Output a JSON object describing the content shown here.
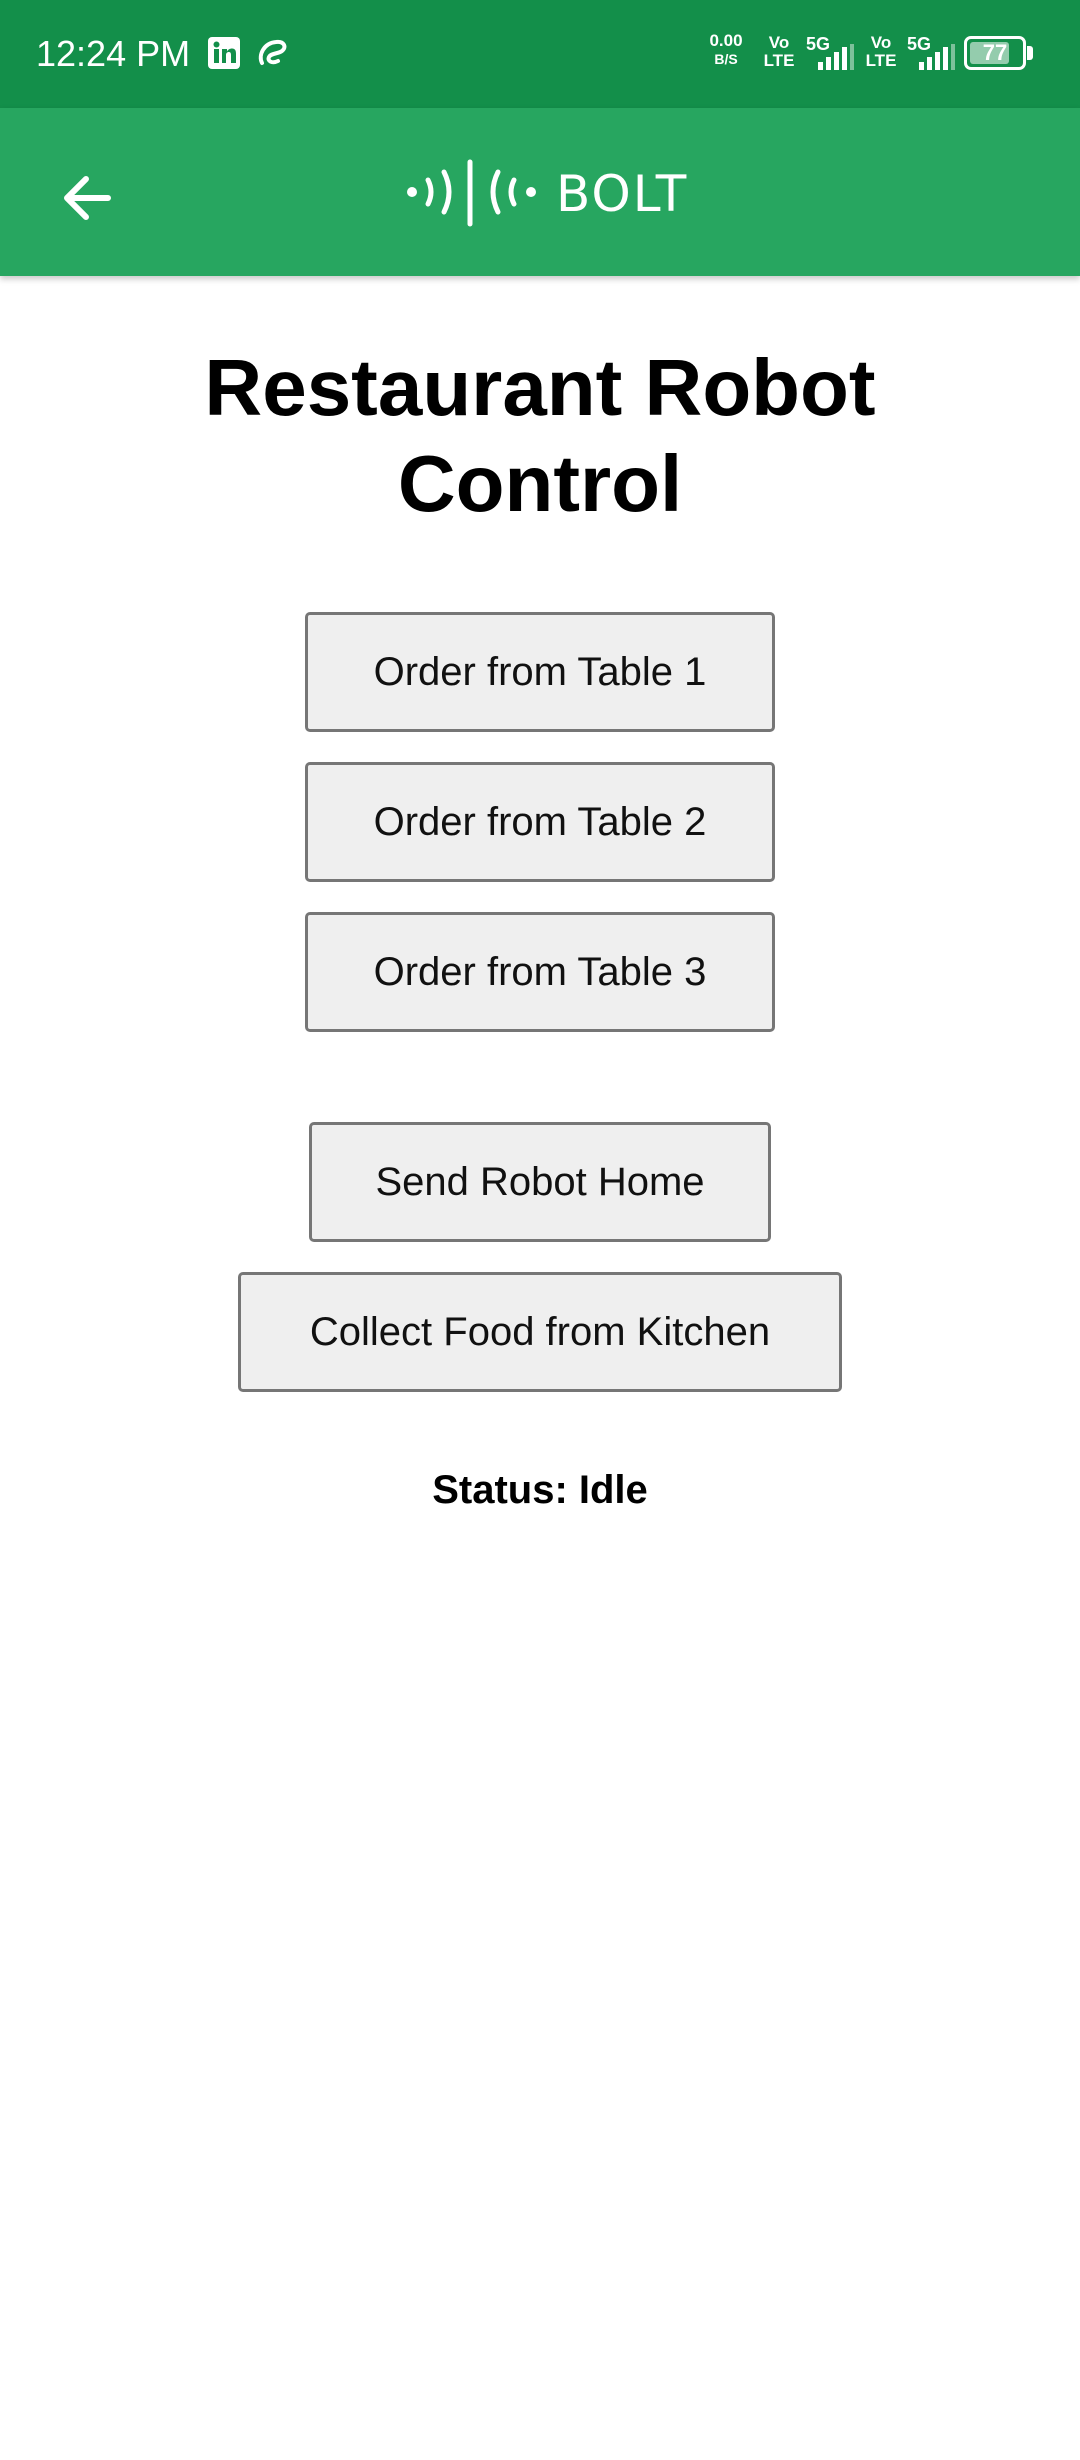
{
  "status_bar": {
    "time": "12:24 PM",
    "net_speed_value": "0.00",
    "net_speed_unit": "B/S",
    "volte_top": "Vo",
    "volte_bottom": "LTE",
    "network_type": "5G",
    "battery_level": "77",
    "battery_fraction": 0.77,
    "icons": [
      "linkedin-icon",
      "app-notification-icon",
      "signal-icon",
      "battery-icon"
    ]
  },
  "app_bar": {
    "brand_name": "BOLT",
    "back_icon": "arrow-left-icon",
    "color": "#27a660"
  },
  "main": {
    "title": "Restaurant Robot Control",
    "buttons": {
      "table_1": "Order from Table 1",
      "table_2": "Order from Table 2",
      "table_3": "Order from Table 3",
      "send_home": "Send Robot Home",
      "collect_food": "Collect Food from Kitchen"
    },
    "status": "Status: Idle"
  },
  "colors": {
    "status_bar": "#138f4a",
    "app_bar": "#27a660",
    "button_bg": "#efefef",
    "button_border": "#767676"
  }
}
